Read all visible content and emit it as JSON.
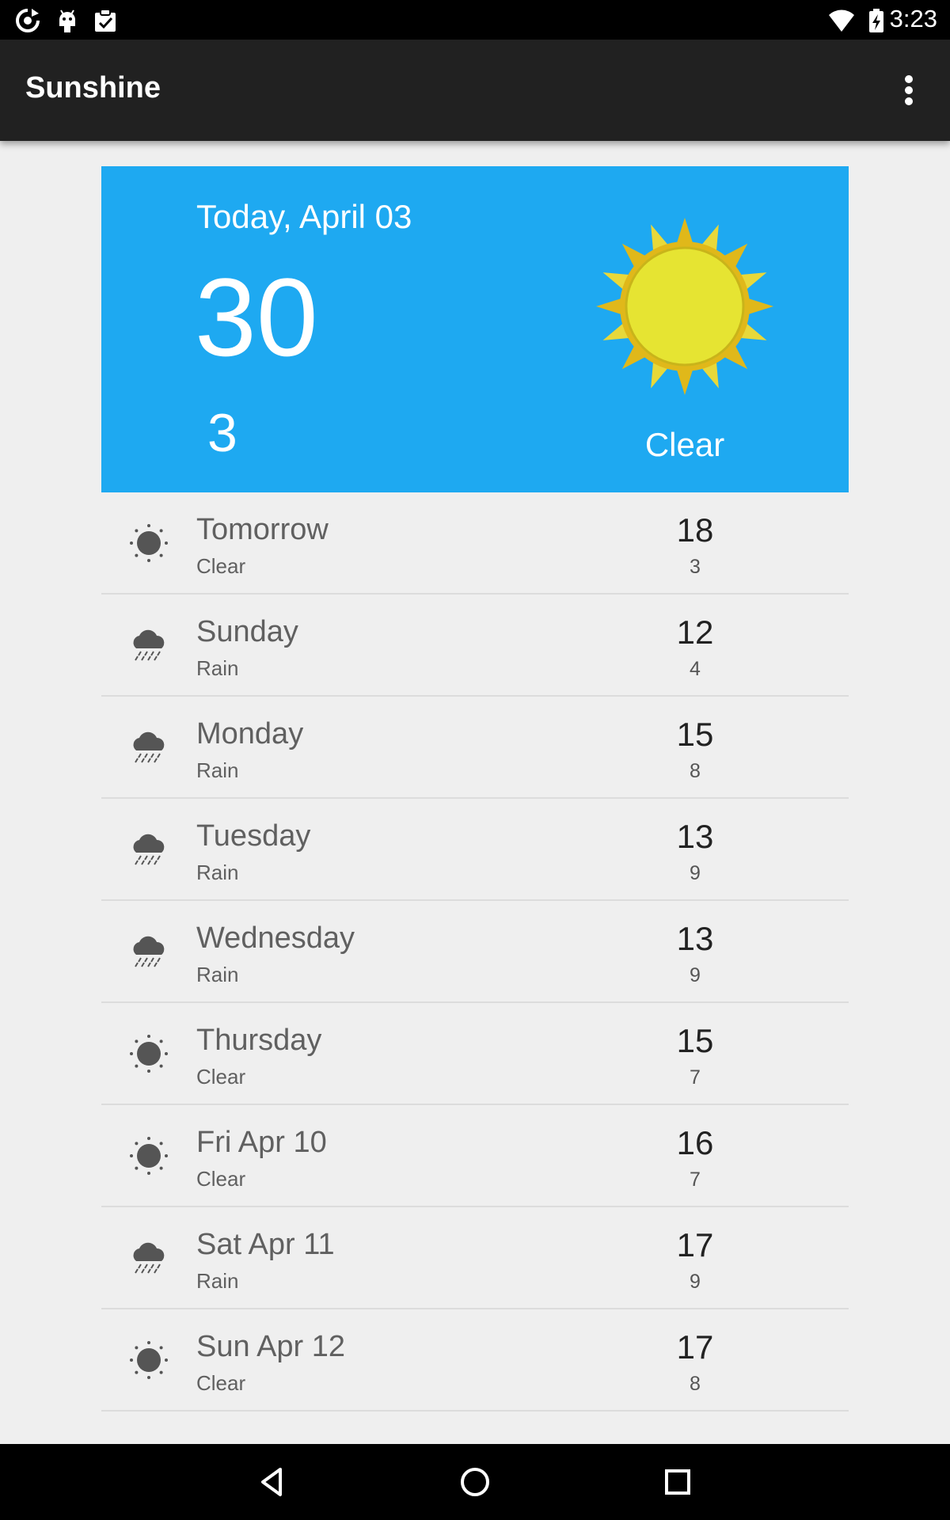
{
  "status_bar": {
    "time": "3:23",
    "icons": [
      "sync-icon",
      "android-icon",
      "clipboard-check-icon",
      "wifi-icon",
      "battery-charging-icon"
    ]
  },
  "app_bar": {
    "title": "Sunshine",
    "menu_icon": "overflow-menu-icon"
  },
  "today": {
    "date": "Today, April 03",
    "high": "30",
    "low": "3",
    "condition": "Clear",
    "icon": "sun-art-icon",
    "card_color": "#1ea9f1"
  },
  "forecast": [
    {
      "day": "Tomorrow",
      "desc": "Clear",
      "high": "18",
      "low": "3",
      "icon": "clear"
    },
    {
      "day": "Sunday",
      "desc": "Rain",
      "high": "12",
      "low": "4",
      "icon": "rain"
    },
    {
      "day": "Monday",
      "desc": "Rain",
      "high": "15",
      "low": "8",
      "icon": "rain"
    },
    {
      "day": "Tuesday",
      "desc": "Rain",
      "high": "13",
      "low": "9",
      "icon": "rain"
    },
    {
      "day": "Wednesday",
      "desc": "Rain",
      "high": "13",
      "low": "9",
      "icon": "rain"
    },
    {
      "day": "Thursday",
      "desc": "Clear",
      "high": "15",
      "low": "7",
      "icon": "clear"
    },
    {
      "day": "Fri Apr 10",
      "desc": "Clear",
      "high": "16",
      "low": "7",
      "icon": "clear"
    },
    {
      "day": "Sat Apr 11",
      "desc": "Rain",
      "high": "17",
      "low": "9",
      "icon": "rain"
    },
    {
      "day": "Sun Apr 12",
      "desc": "Clear",
      "high": "17",
      "low": "8",
      "icon": "clear"
    }
  ],
  "nav_bar": {
    "buttons": [
      "back-icon",
      "home-icon",
      "recents-icon"
    ]
  }
}
